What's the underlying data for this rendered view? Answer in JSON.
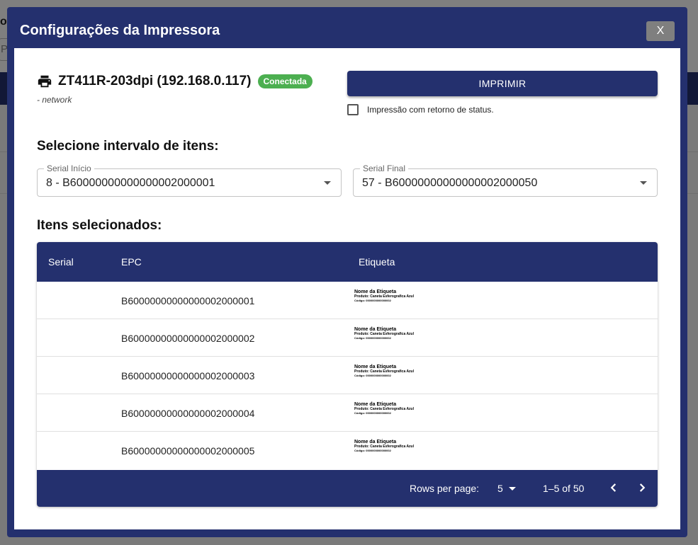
{
  "background": {
    "title_fragment": "ot",
    "input_fragment": "P"
  },
  "dialog": {
    "title": "Configurações da Impressora",
    "close_label": "X"
  },
  "printer": {
    "icon": "printer-icon",
    "name": "ZT411R-203dpi (192.168.0.117)",
    "status": "Conectada",
    "type": "- network"
  },
  "actions": {
    "print_label": "IMPRIMIR",
    "status_return_label": "Impressão com retorno de status.",
    "status_return_checked": false
  },
  "range": {
    "title": "Selecione intervalo de itens:",
    "start": {
      "label": "Serial Início",
      "value": "8 - B60000000000000002000001"
    },
    "end": {
      "label": "Serial Final",
      "value": "57 - B60000000000000002000050"
    }
  },
  "selected": {
    "title": "Itens selecionados:",
    "columns": [
      "Serial",
      "EPC",
      "Etiqueta"
    ],
    "rows": [
      {
        "serial": "",
        "epc": "B60000000000000002000001",
        "label_name": "Nome da Etiqueta",
        "label_product": "Produto: Caneta Esferografica Azul",
        "label_code": "Código: 0000000000000002"
      },
      {
        "serial": "",
        "epc": "B60000000000000002000002",
        "label_name": "Nome da Etiqueta",
        "label_product": "Produto: Caneta Esferografica Azul",
        "label_code": "Código: 0000000000000002"
      },
      {
        "serial": "",
        "epc": "B60000000000000002000003",
        "label_name": "Nome da Etiqueta",
        "label_product": "Produto: Caneta Esferografica Azul",
        "label_code": "Código: 0000000000000002"
      },
      {
        "serial": "",
        "epc": "B60000000000000002000004",
        "label_name": "Nome da Etiqueta",
        "label_product": "Produto: Caneta Esferografica Azul",
        "label_code": "Código: 0000000000000002"
      },
      {
        "serial": "",
        "epc": "B60000000000000002000005",
        "label_name": "Nome da Etiqueta",
        "label_product": "Produto: Caneta Esferografica Azul",
        "label_code": "Código: 0000000000000002"
      }
    ],
    "pagination": {
      "rows_per_page_label": "Rows per page:",
      "rows_per_page": "5",
      "range": "1–5 of 50"
    }
  },
  "colors": {
    "primary": "#24306e",
    "success": "#4caf50"
  }
}
